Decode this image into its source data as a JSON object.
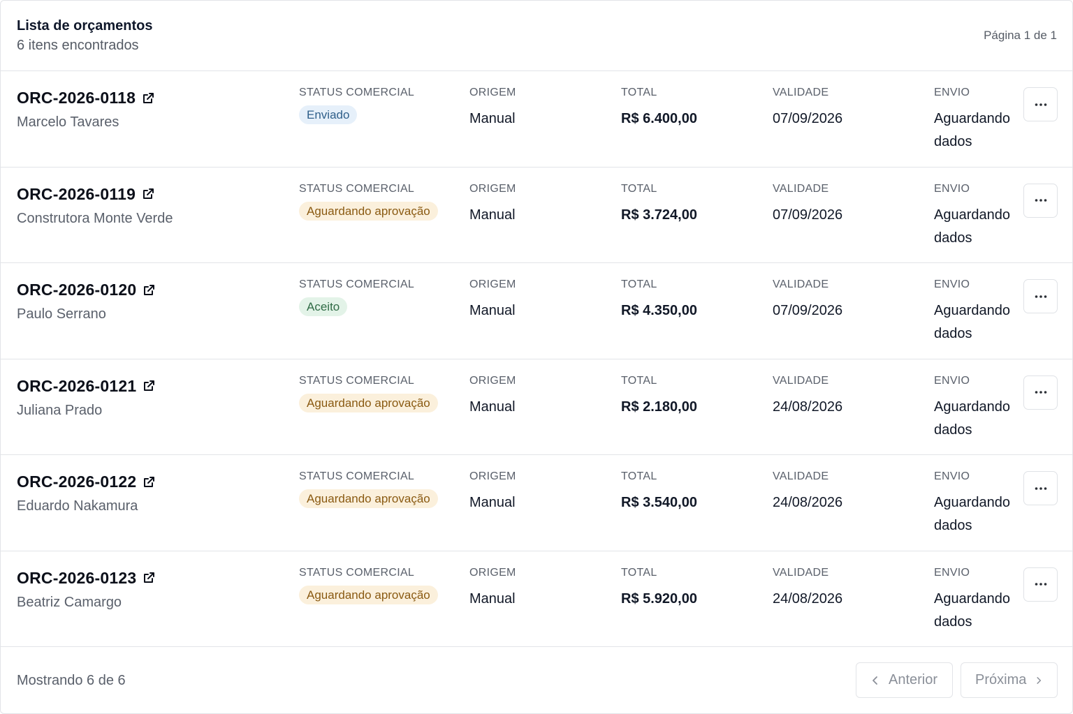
{
  "header": {
    "title": "Lista de orçamentos",
    "subtitle": "6 itens encontrados",
    "page_indicator": "Página 1 de 1"
  },
  "columns": {
    "status": "STATUS COMERCIAL",
    "origem": "ORIGEM",
    "total": "TOTAL",
    "validade": "VALIDADE",
    "envio": "ENVIO"
  },
  "status_colors": {
    "Enviado": {
      "bg": "#e6f0fa",
      "fg": "#2f5f8a"
    },
    "Aguardando aprovação": {
      "bg": "#fbf0dc",
      "fg": "#8a5a12"
    },
    "Aceito": {
      "bg": "#e3f3e8",
      "fg": "#2f6b45"
    }
  },
  "rows": [
    {
      "code": "ORC-2026-0118",
      "client": "Marcelo Tavares",
      "status": "Enviado",
      "origem": "Manual",
      "total": "R$ 6.400,00",
      "validade": "07/09/2026",
      "envio_1": "Aguardando",
      "envio_2": "dados"
    },
    {
      "code": "ORC-2026-0119",
      "client": "Construtora Monte Verde",
      "status": "Aguardando aprovação",
      "origem": "Manual",
      "total": "R$ 3.724,00",
      "validade": "07/09/2026",
      "envio_1": "Aguardando",
      "envio_2": "dados"
    },
    {
      "code": "ORC-2026-0120",
      "client": "Paulo Serrano",
      "status": "Aceito",
      "origem": "Manual",
      "total": "R$ 4.350,00",
      "validade": "07/09/2026",
      "envio_1": "Aguardando",
      "envio_2": "dados"
    },
    {
      "code": "ORC-2026-0121",
      "client": "Juliana Prado",
      "status": "Aguardando aprovação",
      "origem": "Manual",
      "total": "R$ 2.180,00",
      "validade": "24/08/2026",
      "envio_1": "Aguardando",
      "envio_2": "dados"
    },
    {
      "code": "ORC-2026-0122",
      "client": "Eduardo Nakamura",
      "status": "Aguardando aprovação",
      "origem": "Manual",
      "total": "R$ 3.540,00",
      "validade": "24/08/2026",
      "envio_1": "Aguardando",
      "envio_2": "dados"
    },
    {
      "code": "ORC-2026-0123",
      "client": "Beatriz Camargo",
      "status": "Aguardando aprovação",
      "origem": "Manual",
      "total": "R$ 5.920,00",
      "validade": "24/08/2026",
      "envio_1": "Aguardando",
      "envio_2": "dados"
    }
  ],
  "footer": {
    "count": "Mostrando 6 de 6",
    "prev_label": "Anterior",
    "next_label": "Próxima"
  },
  "icons": {
    "external_link": "external-link-icon",
    "more": "more-horizontal-icon",
    "prev": "chevron-left-icon",
    "next": "chevron-right-icon"
  }
}
